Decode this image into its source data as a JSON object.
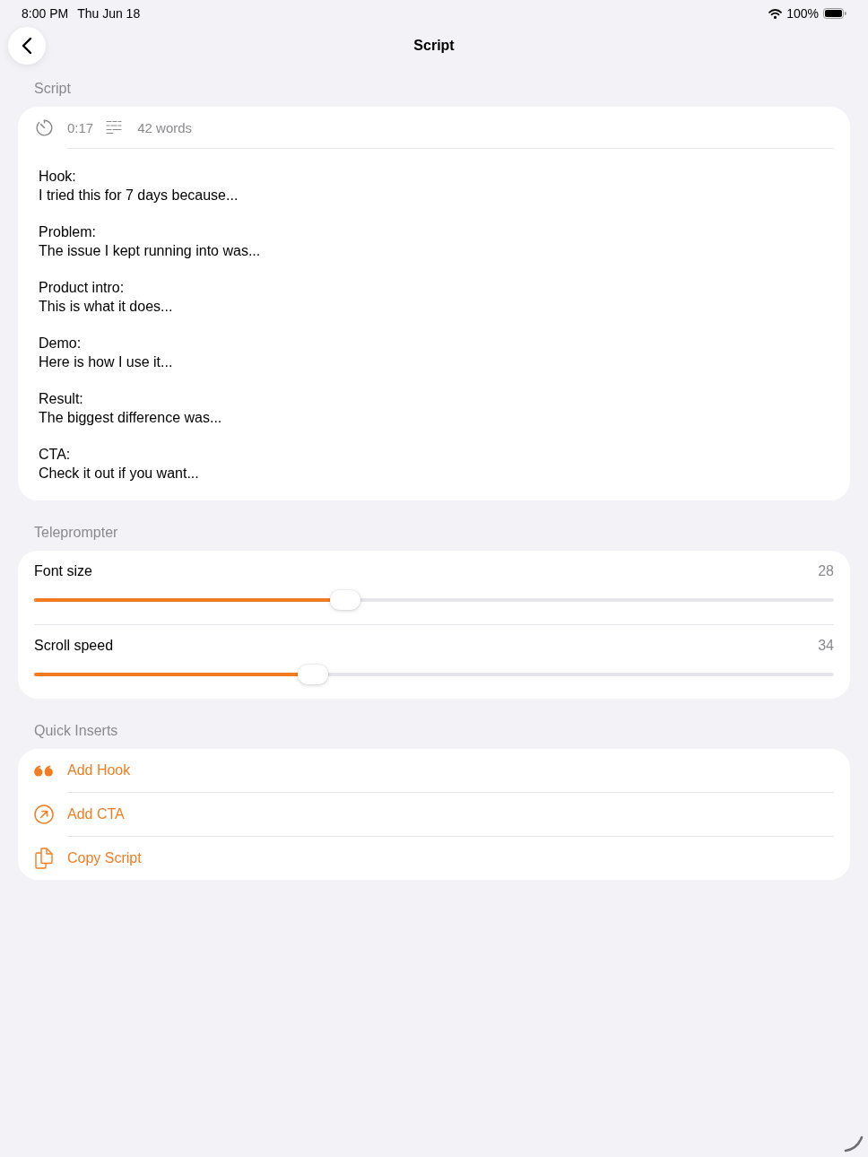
{
  "status_bar": {
    "time": "8:00 PM",
    "date": "Thu Jun 18",
    "battery": "100%"
  },
  "nav": {
    "title": "Script"
  },
  "script_section": {
    "header": "Script",
    "duration": "0:17",
    "word_count": "42 words",
    "blocks": [
      {
        "label": "Hook:",
        "text": "I tried this for 7 days because..."
      },
      {
        "label": "Problem:",
        "text": "The issue I kept running into was..."
      },
      {
        "label": "Product intro:",
        "text": "This is what it does..."
      },
      {
        "label": "Demo:",
        "text": "Here is how I use it..."
      },
      {
        "label": "Result:",
        "text": "The biggest difference was..."
      },
      {
        "label": "CTA:",
        "text": "Check it out if you want..."
      }
    ]
  },
  "teleprompter": {
    "header": "Teleprompter",
    "sliders": [
      {
        "label": "Font size",
        "value": "28",
        "level": 0.385
      },
      {
        "label": "Scroll speed",
        "value": "34",
        "level": 0.343
      }
    ]
  },
  "quick_inserts": {
    "header": "Quick Inserts",
    "items": [
      {
        "kind": "quote",
        "label": "Add Hook"
      },
      {
        "kind": "arrow",
        "label": "Add CTA"
      },
      {
        "kind": "copy",
        "label": "Copy Script"
      }
    ]
  }
}
